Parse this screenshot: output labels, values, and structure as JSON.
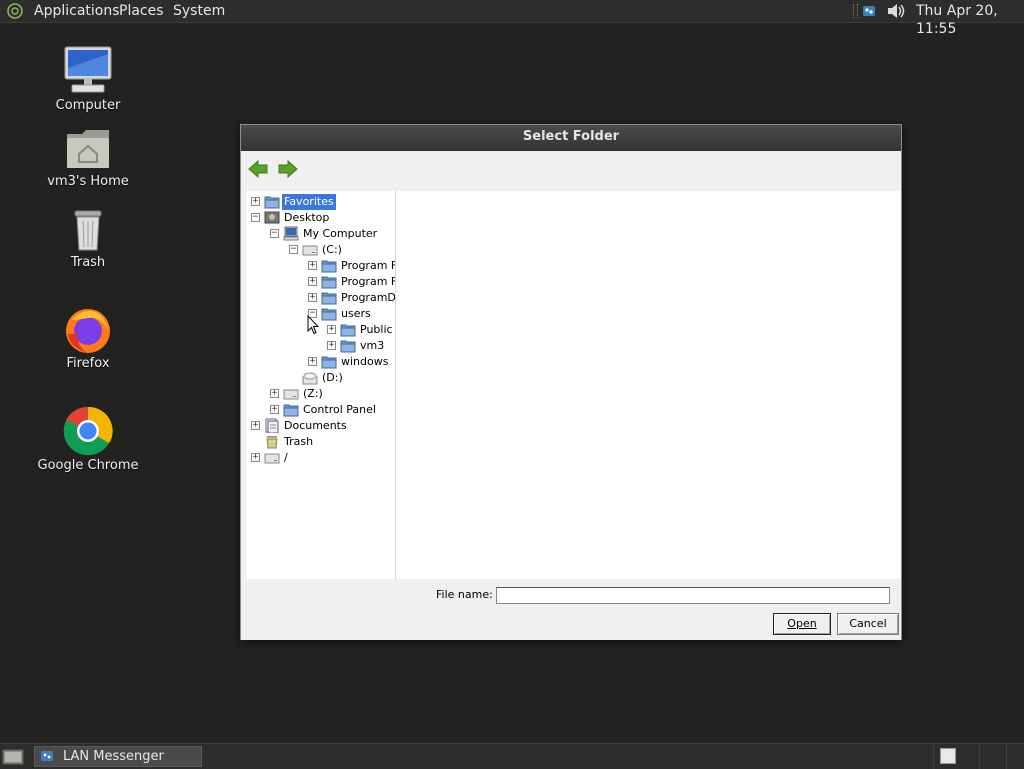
{
  "top_panel": {
    "menus": [
      "Applications",
      "Places",
      "System"
    ],
    "clock": "Thu Apr 20, 11:55"
  },
  "desktop_icons": [
    {
      "label": "Computer",
      "icon": "computer-icon"
    },
    {
      "label": "vm3's Home",
      "icon": "home-folder-icon"
    },
    {
      "label": "Trash",
      "icon": "trash-icon"
    },
    {
      "label": "Firefox",
      "icon": "firefox-icon"
    },
    {
      "label": "Google Chrome",
      "icon": "chrome-icon"
    }
  ],
  "dialog": {
    "title": "Select Folder",
    "tree": [
      {
        "label": "Favorites",
        "expander": "+",
        "icon": "folder-icon",
        "selected": true
      },
      {
        "label": "Desktop",
        "expander": "−",
        "icon": "desktop-icon"
      },
      {
        "label": "My Computer",
        "expander": "−",
        "icon": "computer-icon"
      },
      {
        "label": "(C:)",
        "expander": "−",
        "icon": "drive-icon"
      },
      {
        "label": "Program Fi",
        "expander": "+",
        "icon": "folder-icon"
      },
      {
        "label": "Program Fi",
        "expander": "+",
        "icon": "folder-icon"
      },
      {
        "label": "ProgramDa",
        "expander": "+",
        "icon": "folder-icon"
      },
      {
        "label": "users",
        "expander": "−",
        "icon": "folder-icon"
      },
      {
        "label": "Public",
        "expander": "+",
        "icon": "folder-icon"
      },
      {
        "label": "vm3",
        "expander": "+",
        "icon": "folder-icon"
      },
      {
        "label": "windows",
        "expander": "+",
        "icon": "folder-icon"
      },
      {
        "label": "(D:)",
        "expander": "",
        "icon": "cd-drive-icon"
      },
      {
        "label": "(Z:)",
        "expander": "+",
        "icon": "drive-icon"
      },
      {
        "label": "Control Panel",
        "expander": "+",
        "icon": "folder-icon"
      },
      {
        "label": "Documents",
        "expander": "+",
        "icon": "documents-icon"
      },
      {
        "label": "Trash",
        "expander": "",
        "icon": "trash-icon"
      },
      {
        "label": "/",
        "expander": "+",
        "icon": "drive-icon"
      }
    ],
    "file_name_label": "File name:",
    "file_name_value": "",
    "open_label": "Open",
    "cancel_label": "Cancel"
  },
  "taskbar": {
    "task_label": "LAN Messenger"
  },
  "colors": {
    "desktop_bg": "#222321",
    "panel_bg": "#2d2d2b",
    "selection": "#3c78d8",
    "nav_arrow": "#5aa02c"
  }
}
